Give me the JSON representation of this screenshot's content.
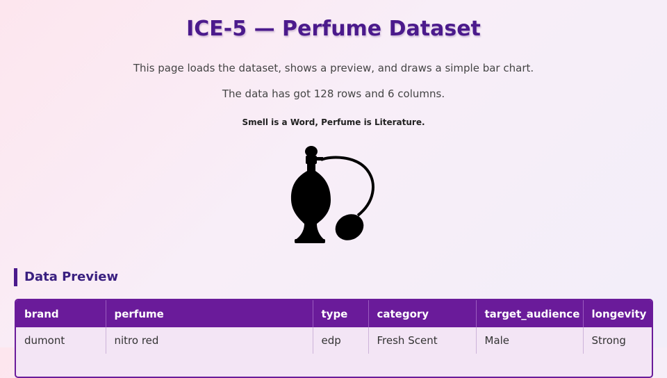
{
  "page": {
    "title": "ICE-5 — Perfume Dataset",
    "intro": "This page loads the dataset, shows a preview, and draws a simple bar chart.",
    "summary": "The data has got 128 rows and 6 columns.",
    "tagline": "Smell is a Word, Perfume is Literature."
  },
  "icon": {
    "name": "perfume-bottle-icon",
    "color": "#000000"
  },
  "preview": {
    "heading": "Data Preview",
    "columns": [
      "brand",
      "perfume",
      "type",
      "category",
      "target_audience",
      "longevity"
    ],
    "rows": [
      [
        "dumont",
        "nitro red",
        "edp",
        "Fresh Scent",
        "Male",
        "Strong"
      ]
    ]
  },
  "colors": {
    "title": "#4b1a8c",
    "table_header": "#6a1b9a",
    "table_row": "#f3e5f5",
    "accent": "#4b1a8c"
  }
}
